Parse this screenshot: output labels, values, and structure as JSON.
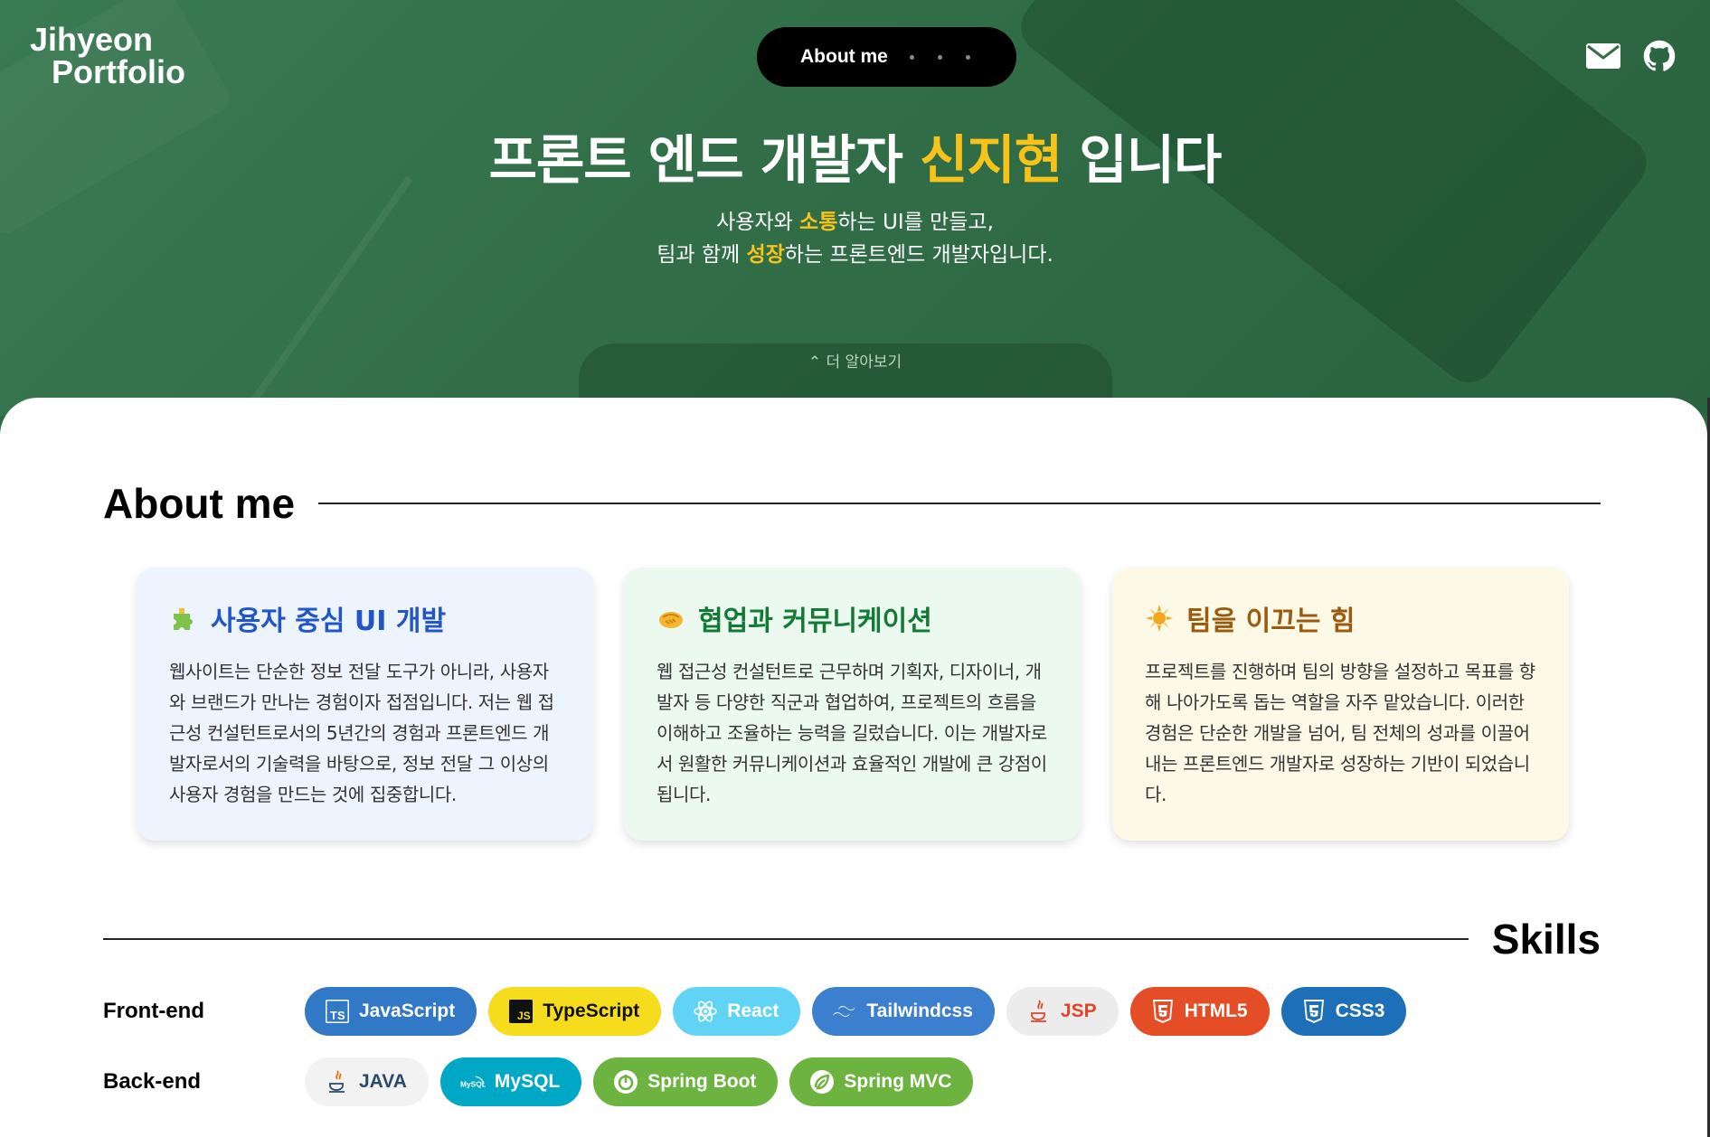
{
  "brand": {
    "line1": "Jihyeon",
    "line2": "Portfolio"
  },
  "nav": {
    "label": "About me"
  },
  "icons": {
    "mail": "mail-icon",
    "github": "github-icon"
  },
  "hero": {
    "title_pre": "프론트 엔드 개발자 ",
    "title_highlight": "신지현",
    "title_post": " 입니다",
    "line1_pre": "사용자와 ",
    "line1_highlight": "소통",
    "line1_post": "하는 UI를 만들고,",
    "line2_pre": "팀과 함께 ",
    "line2_highlight": "성장",
    "line2_post": "하는 프론트엔드 개발자입니다.",
    "more_label": "⌃ 더 알아보기"
  },
  "about": {
    "heading": "About me",
    "cards": [
      {
        "icon": "puzzle-icon",
        "title": "사용자 중심 UI 개발",
        "text": "웹사이트는 단순한 정보 전달 도구가 아니라, 사용자와 브랜드가 만나는 경험이자 접점입니다. 저는 웹 접근성 컨설턴트로서의 5년간의 경험과 프론트엔드 개발자로서의 기술력을 바탕으로, 정보 전달 그 이상의 사용자 경험을 만드는 것에 집중합니다."
      },
      {
        "icon": "handshake-icon",
        "title": "협업과 커뮤니케이션",
        "text": "웹 접근성 컨설턴트로 근무하며 기획자, 디자이너, 개발자 등 다양한 직군과 협업하여, 프로젝트의 흐름을 이해하고 조율하는 능력을 길렀습니다. 이는 개발자로서 원활한 커뮤니케이션과 효율적인 개발에 큰 강점이 됩니다."
      },
      {
        "icon": "sun-icon",
        "title": "팀을 이끄는 힘",
        "text": "프로젝트를 진행하며 팀의 방향을 설정하고 목표를 향해 나아가도록 돕는 역할을 자주 맡았습니다. 이러한 경험은 단순한 개발을 넘어, 팀 전체의 성과를 이끌어내는 프론트엔드 개발자로 성장하는 기반이 되었습니다."
      }
    ]
  },
  "skills": {
    "heading": "Skills",
    "rows": [
      {
        "category": "Front-end",
        "items": [
          {
            "label": "JavaScript",
            "icon": "ts-icon",
            "bg": "#3178c6",
            "fg": "#ffffff"
          },
          {
            "label": "TypeScript",
            "icon": "js-icon",
            "bg": "#f5dd1e",
            "fg": "#111111"
          },
          {
            "label": "React",
            "icon": "react-icon",
            "bg": "#61d4f5",
            "fg": "#ffffff"
          },
          {
            "label": "Tailwindcss",
            "icon": "tailwind-icon",
            "bg": "#3b7fce",
            "fg": "#ffffff"
          },
          {
            "label": "JSP",
            "icon": "java-icon",
            "bg": "#ececec",
            "fg": "#e0452a"
          },
          {
            "label": "HTML5",
            "icon": "html5-icon",
            "bg": "#e44d26",
            "fg": "#ffffff"
          },
          {
            "label": "CSS3",
            "icon": "css3-icon",
            "bg": "#1d6fb8",
            "fg": "#ffffff"
          }
        ]
      },
      {
        "category": "Back-end",
        "items": [
          {
            "label": "JAVA",
            "icon": "java-icon",
            "bg": "#f2f2f2",
            "fg": "#2a4a6a"
          },
          {
            "label": "MySQL",
            "icon": "mysql-icon",
            "bg": "#00a8c6",
            "fg": "#ffffff"
          },
          {
            "label": "Spring Boot",
            "icon": "spring-boot-icon",
            "bg": "#6db33f",
            "fg": "#ffffff"
          },
          {
            "label": "Spring MVC",
            "icon": "spring-icon",
            "bg": "#6db33f",
            "fg": "#ffffff"
          }
        ]
      }
    ]
  },
  "colors": {
    "accent": "#f7c21a",
    "hero_bg": "#326f49"
  }
}
